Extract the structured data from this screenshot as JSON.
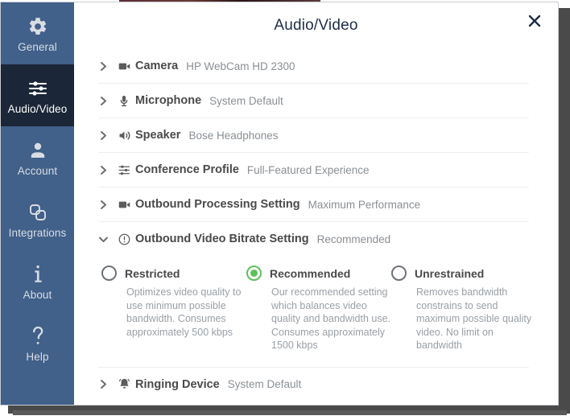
{
  "window": {
    "title": "Audio/Video",
    "close_label": "×"
  },
  "colors": {
    "sidebar_bg": "#41608a",
    "sidebar_active_bg": "#1b2638",
    "title_text": "#1f2d4a",
    "accent_green": "#5cc15c",
    "row_label": "#4a4a4a",
    "row_value": "#8a8f94"
  },
  "sidebar": {
    "items": [
      {
        "label": "General",
        "icon": "gear-icon",
        "active": false
      },
      {
        "label": "Audio/Video",
        "icon": "sliders-icon",
        "active": true
      },
      {
        "label": "Account",
        "icon": "person-icon",
        "active": false
      },
      {
        "label": "Integrations",
        "icon": "squares-icon",
        "active": false
      },
      {
        "label": "About",
        "icon": "info-i-icon",
        "active": false
      },
      {
        "label": "Help",
        "icon": "question-icon",
        "active": false
      }
    ]
  },
  "settings": {
    "rows": [
      {
        "label": "Camera",
        "value": "HP WebCam HD 2300",
        "icon": "camera-icon",
        "expanded": false
      },
      {
        "label": "Microphone",
        "value": "System Default",
        "icon": "mic-icon",
        "expanded": false
      },
      {
        "label": "Speaker",
        "value": "Bose Headphones",
        "icon": "speaker-icon",
        "expanded": false
      },
      {
        "label": "Conference Profile",
        "value": "Full-Featured Experience",
        "icon": "sliders-icon",
        "expanded": false
      },
      {
        "label": "Outbound Processing Setting",
        "value": "Maximum Performance",
        "icon": "camera-icon",
        "expanded": false
      },
      {
        "label": "Outbound Video Bitrate Setting",
        "value": "Recommended",
        "icon": "info-icon",
        "expanded": true
      }
    ],
    "bitrate_options": [
      {
        "label": "Restricted",
        "description": "Optimizes video quality to use minimum possible bandwidth. Consumes approximately 500 kbps",
        "selected": false
      },
      {
        "label": "Recommended",
        "description": "Our recommended setting which balances video quality and bandwidth use. Consumes approximately 1500 kbps",
        "selected": true
      },
      {
        "label": "Unrestrained",
        "description": "Removes bandwidth constrains to send maximum possible quality video. No limit on bandwidth",
        "selected": false
      }
    ],
    "ringing_row": {
      "label": "Ringing Device",
      "value": "System Default",
      "icon": "bell-icon"
    }
  }
}
